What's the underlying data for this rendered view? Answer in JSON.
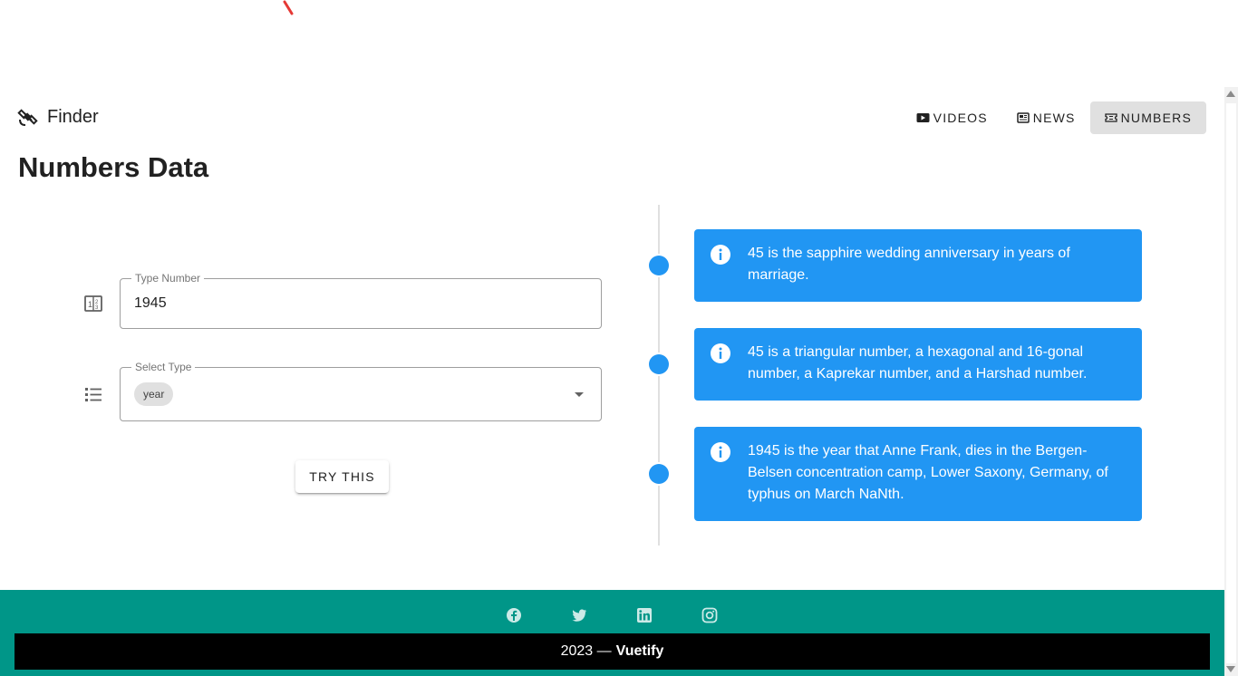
{
  "header": {
    "brand": "Finder",
    "nav": [
      {
        "label": "VIDEOS",
        "icon": "video-icon",
        "active": false
      },
      {
        "label": "NEWS",
        "icon": "newspaper-icon",
        "active": false
      },
      {
        "label": "NUMBERS",
        "icon": "ticket-icon",
        "active": true
      }
    ]
  },
  "page": {
    "title": "Numbers Data"
  },
  "form": {
    "number_label": "Type Number",
    "number_value": "1945",
    "type_label": "Select Type",
    "type_chip": "year",
    "submit_label": "TRY THIS"
  },
  "timeline": [
    {
      "text": "45 is the sapphire wedding anniversary in years of marriage."
    },
    {
      "text": "45 is a triangular number, a hexagonal and 16-gonal number, a Kaprekar number, and a Harshad number."
    },
    {
      "text": "1945 is the year that Anne Frank, dies in the Bergen-Belsen concentration camp, Lower Saxony, Germany, of typhus on March NaNth."
    }
  ],
  "footer": {
    "social": [
      "facebook-icon",
      "twitter-icon",
      "linkedin-icon",
      "instagram-icon"
    ],
    "year_text": "2023 —",
    "brand": "Vuetify"
  },
  "colors": {
    "primary": "#2196f3",
    "footer": "#009688",
    "footer_bar": "#000000"
  }
}
